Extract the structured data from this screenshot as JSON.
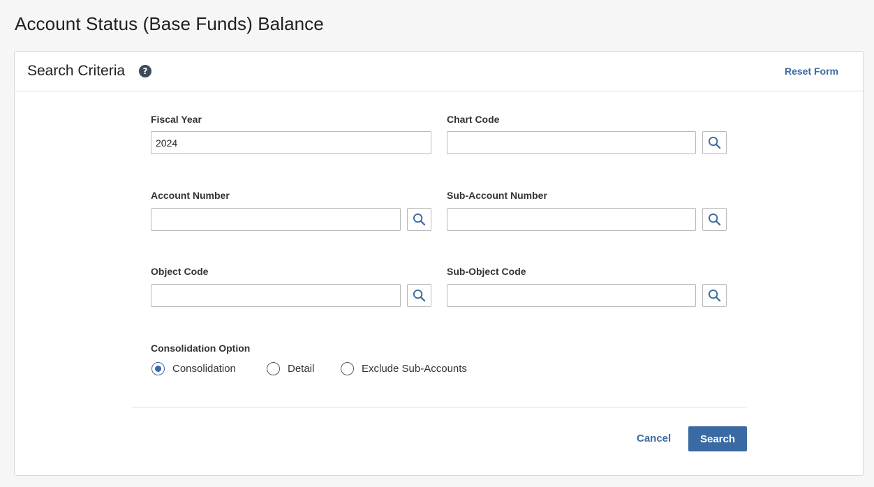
{
  "page": {
    "title": "Account Status (Base Funds) Balance"
  },
  "panel": {
    "title": "Search Criteria",
    "help_icon": "?",
    "reset_label": "Reset Form"
  },
  "fields": {
    "fiscal_year": {
      "label": "Fiscal Year",
      "value": "2024"
    },
    "chart_code": {
      "label": "Chart Code",
      "value": ""
    },
    "account_number": {
      "label": "Account Number",
      "value": ""
    },
    "sub_account_number": {
      "label": "Sub-Account Number",
      "value": ""
    },
    "object_code": {
      "label": "Object Code",
      "value": ""
    },
    "sub_object_code": {
      "label": "Sub-Object Code",
      "value": ""
    }
  },
  "consolidation": {
    "label": "Consolidation Option",
    "options": [
      "Consolidation",
      "Detail",
      "Exclude Sub-Accounts"
    ],
    "selected": "Consolidation"
  },
  "actions": {
    "cancel_label": "Cancel",
    "search_label": "Search"
  },
  "colors": {
    "accent": "#3a6aa3",
    "help_icon_bg": "#3d4a57",
    "page_bg": "#f6f6f6"
  },
  "icons": {
    "lookup": "magnifier-icon",
    "help": "question-circle-icon"
  }
}
